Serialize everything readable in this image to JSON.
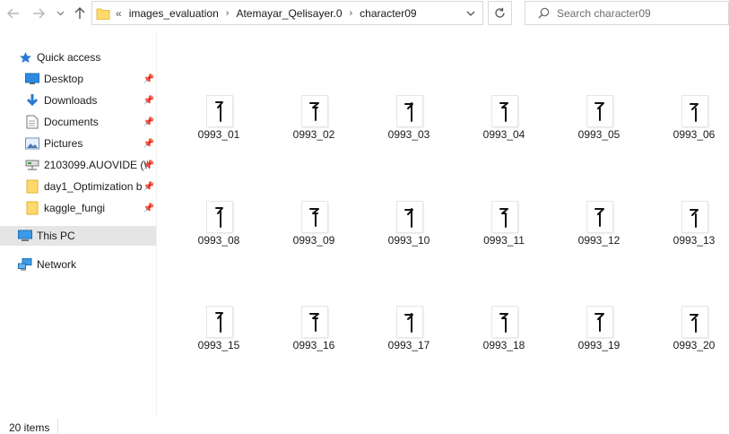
{
  "address_bar": {
    "overflow": "«",
    "crumbs": [
      "images_evaluation",
      "Atemayar_Qelisayer.0",
      "character09"
    ]
  },
  "search": {
    "placeholder": "Search character09"
  },
  "sidebar": {
    "quick_access": "Quick access",
    "items": [
      {
        "label": "Desktop",
        "icon": "desktop-icon",
        "pinned": true
      },
      {
        "label": "Downloads",
        "icon": "download-arrow-icon",
        "pinned": true
      },
      {
        "label": "Documents",
        "icon": "document-icon",
        "pinned": true
      },
      {
        "label": "Pictures",
        "icon": "picture-icon",
        "pinned": true
      },
      {
        "label": "2103099.AUOVIDE (\\\\",
        "icon": "network-drive-icon",
        "pinned": true
      },
      {
        "label": "day1_Optimization b",
        "icon": "folder-icon",
        "pinned": true
      },
      {
        "label": "kaggle_fungi",
        "icon": "folder-icon",
        "pinned": true
      }
    ],
    "this_pc": "This PC",
    "network": "Network"
  },
  "files": [
    "0993_01",
    "0993_02",
    "0993_03",
    "0993_04",
    "0993_05",
    "0993_06",
    "0993_08",
    "0993_09",
    "0993_10",
    "0993_11",
    "0993_12",
    "0993_13",
    "0993_15",
    "0993_16",
    "0993_17",
    "0993_18",
    "0993_19",
    "0993_20"
  ],
  "status": {
    "item_count": "20 items"
  }
}
